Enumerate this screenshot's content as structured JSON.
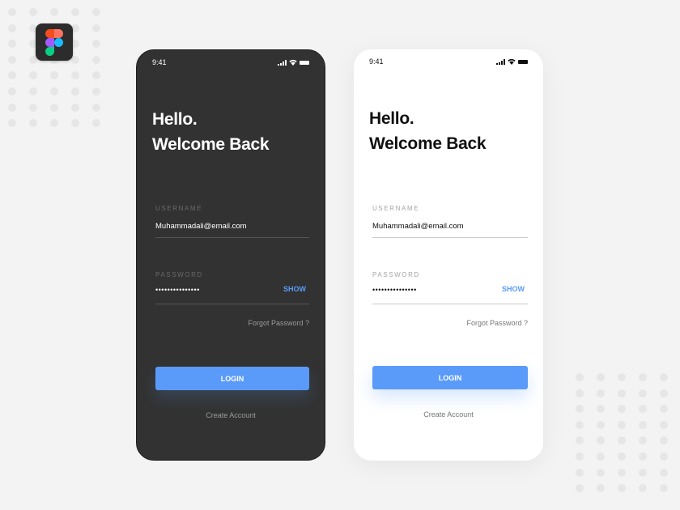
{
  "brand": {
    "logo_icon": "figma-logo-icon",
    "colors": {
      "red": "#f24e1e",
      "salmon": "#ff7262",
      "purple": "#a259ff",
      "blue": "#1abcfe",
      "green": "#0acf83"
    }
  },
  "screens": [
    {
      "theme": "dark",
      "status_bar": {
        "time": "9:41",
        "icons": [
          "signal-icon",
          "wifi-icon",
          "battery-icon"
        ]
      },
      "title_line1": "Hello.",
      "title_line2": "Welcome Back",
      "username_label": "USERNAME",
      "username_value": "Muhammadali@email.com",
      "password_label": "PASSWORD",
      "password_value": "•••••••••••••••",
      "show_label": "SHOW",
      "forgot_label": "Forgot Password ?",
      "login_label": "LOGIN",
      "create_label": "Create Account"
    },
    {
      "theme": "light",
      "status_bar": {
        "time": "9:41",
        "icons": [
          "signal-icon",
          "wifi-icon",
          "battery-icon"
        ]
      },
      "title_line1": "Hello.",
      "title_line2": "Welcome Back",
      "username_label": "USERNAME",
      "username_value": "Muhammadali@email.com",
      "password_label": "PASSWORD",
      "password_value": "•••••••••••••••",
      "show_label": "SHOW",
      "forgot_label": "Forgot Password ?",
      "login_label": "LOGIN",
      "create_label": "Create Account"
    }
  ],
  "accent_color": "#5a9bfa"
}
